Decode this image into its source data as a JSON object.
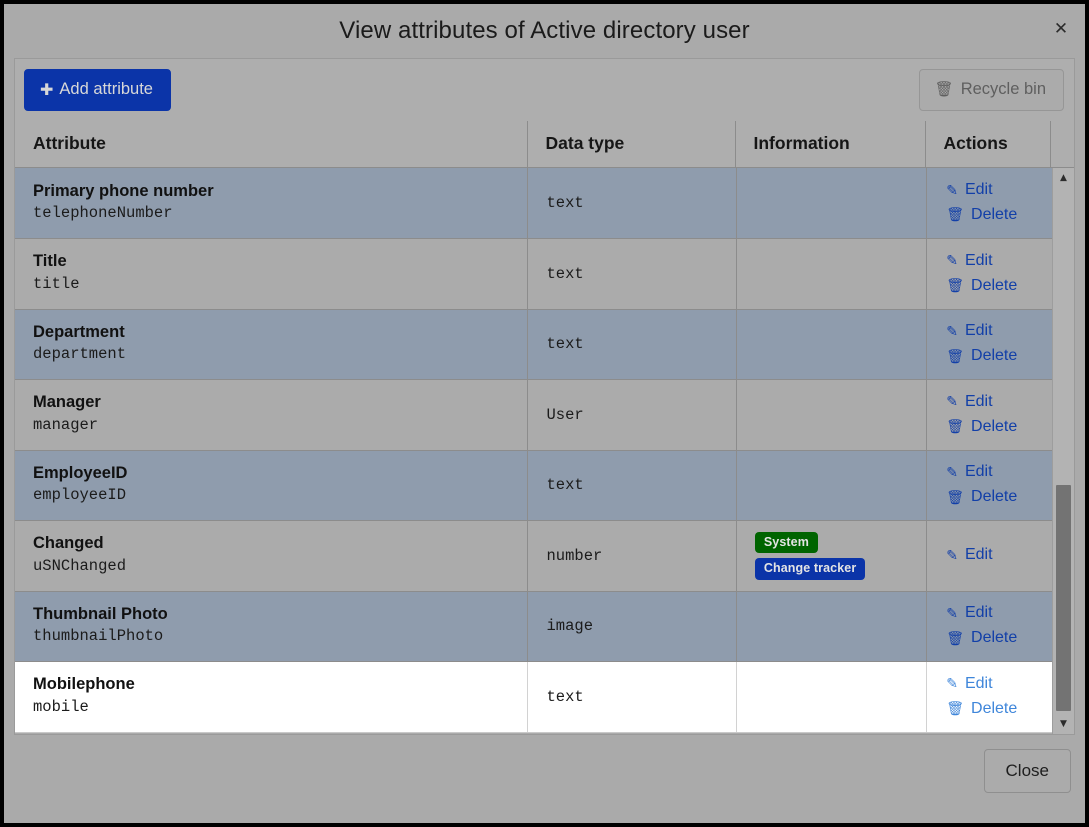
{
  "dialog": {
    "title": "View attributes of Active directory user",
    "close_icon": "close-icon",
    "close_button_label": "Close"
  },
  "toolbar": {
    "add_label": "Add attribute",
    "add_icon": "plus-icon",
    "recycle_label": "Recycle bin",
    "recycle_icon": "trash-icon"
  },
  "table": {
    "columns": [
      "Attribute",
      "Data type",
      "Information",
      "Actions"
    ],
    "rows": [
      {
        "name": "Primary phone number",
        "ldap": "telephoneNumber",
        "type": "text",
        "badges": [],
        "actions": [
          "Edit",
          "Delete"
        ],
        "row_state": "odd"
      },
      {
        "name": "Title",
        "ldap": "title",
        "type": "text",
        "badges": [],
        "actions": [
          "Edit",
          "Delete"
        ],
        "row_state": "even"
      },
      {
        "name": "Department",
        "ldap": "department",
        "type": "text",
        "badges": [],
        "actions": [
          "Edit",
          "Delete"
        ],
        "row_state": "odd"
      },
      {
        "name": "Manager",
        "ldap": "manager",
        "type": "User",
        "badges": [],
        "actions": [
          "Edit",
          "Delete"
        ],
        "row_state": "even"
      },
      {
        "name": "EmployeeID",
        "ldap": "employeeID",
        "type": "text",
        "badges": [],
        "actions": [
          "Edit",
          "Delete"
        ],
        "row_state": "odd"
      },
      {
        "name": "Changed",
        "ldap": "uSNChanged",
        "type": "number",
        "badges": [
          {
            "label": "System",
            "color": "#006400"
          },
          {
            "label": "Change tracker",
            "color": "#0b34a8"
          }
        ],
        "actions": [
          "Edit"
        ],
        "row_state": "even"
      },
      {
        "name": "Thumbnail Photo",
        "ldap": "thumbnailPhoto",
        "type": "image",
        "badges": [],
        "actions": [
          "Edit",
          "Delete"
        ],
        "row_state": "odd"
      },
      {
        "name": "Mobilephone",
        "ldap": "mobile",
        "type": "text",
        "badges": [],
        "actions": [
          "Edit",
          "Delete"
        ],
        "row_state": "hover"
      }
    ]
  },
  "scrollbar": {
    "up_icon": "caret-up-icon",
    "down_icon": "caret-down-icon",
    "thumb_top_pct": 56.5,
    "thumb_height_pct": 43
  },
  "colors": {
    "primary": "#0b34a8",
    "row_odd": "#8f9cad",
    "row_even": "#ababab",
    "link": "#123fa8",
    "badge_system": "#006400",
    "badge_tracker": "#0b34a8"
  }
}
